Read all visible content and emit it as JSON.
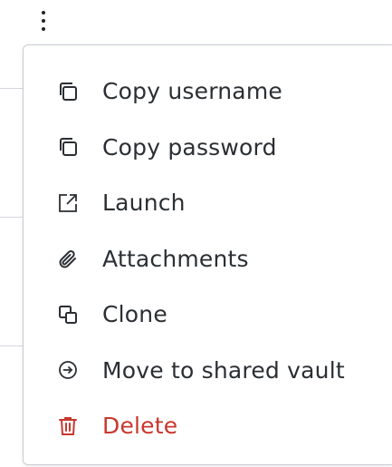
{
  "menu": {
    "items": [
      {
        "label": "Copy username",
        "icon": "copy-icon"
      },
      {
        "label": "Copy password",
        "icon": "copy-icon"
      },
      {
        "label": "Launch",
        "icon": "external-link-icon"
      },
      {
        "label": "Attachments",
        "icon": "paperclip-icon"
      },
      {
        "label": "Clone",
        "icon": "clone-icon"
      },
      {
        "label": "Move to shared vault",
        "icon": "arrow-circle-right-icon"
      },
      {
        "label": "Delete",
        "icon": "trash-icon"
      }
    ]
  },
  "colors": {
    "text": "#2b2f33",
    "danger": "#c8372f",
    "border": "#c8ccd2"
  }
}
